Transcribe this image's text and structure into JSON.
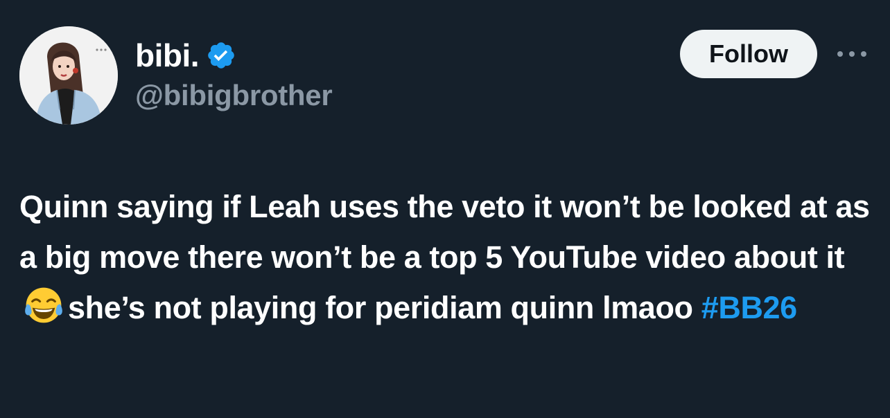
{
  "user": {
    "display_name": "bibi.",
    "handle": "@bibigbrother",
    "verified": true,
    "avatar_icon": "avatar-illustration-icon"
  },
  "actions": {
    "follow_label": "Follow",
    "more_icon": "more-options-icon"
  },
  "tweet": {
    "text_before_emoji": "Quinn saying if Leah uses the veto it won’t be looked at as a big move there won’t be a top 5 YouTube video about it",
    "emoji": "face-with-tears-of-joy-emoji",
    "text_after_emoji": "she’s not playing for peridiam quinn lmaoo",
    "hashtag": "#BB26"
  },
  "colors": {
    "background": "#15202b",
    "text_primary": "#ffffff",
    "text_secondary": "#8b98a5",
    "accent": "#1d9bf0",
    "follow_button_bg": "#eff3f4"
  }
}
